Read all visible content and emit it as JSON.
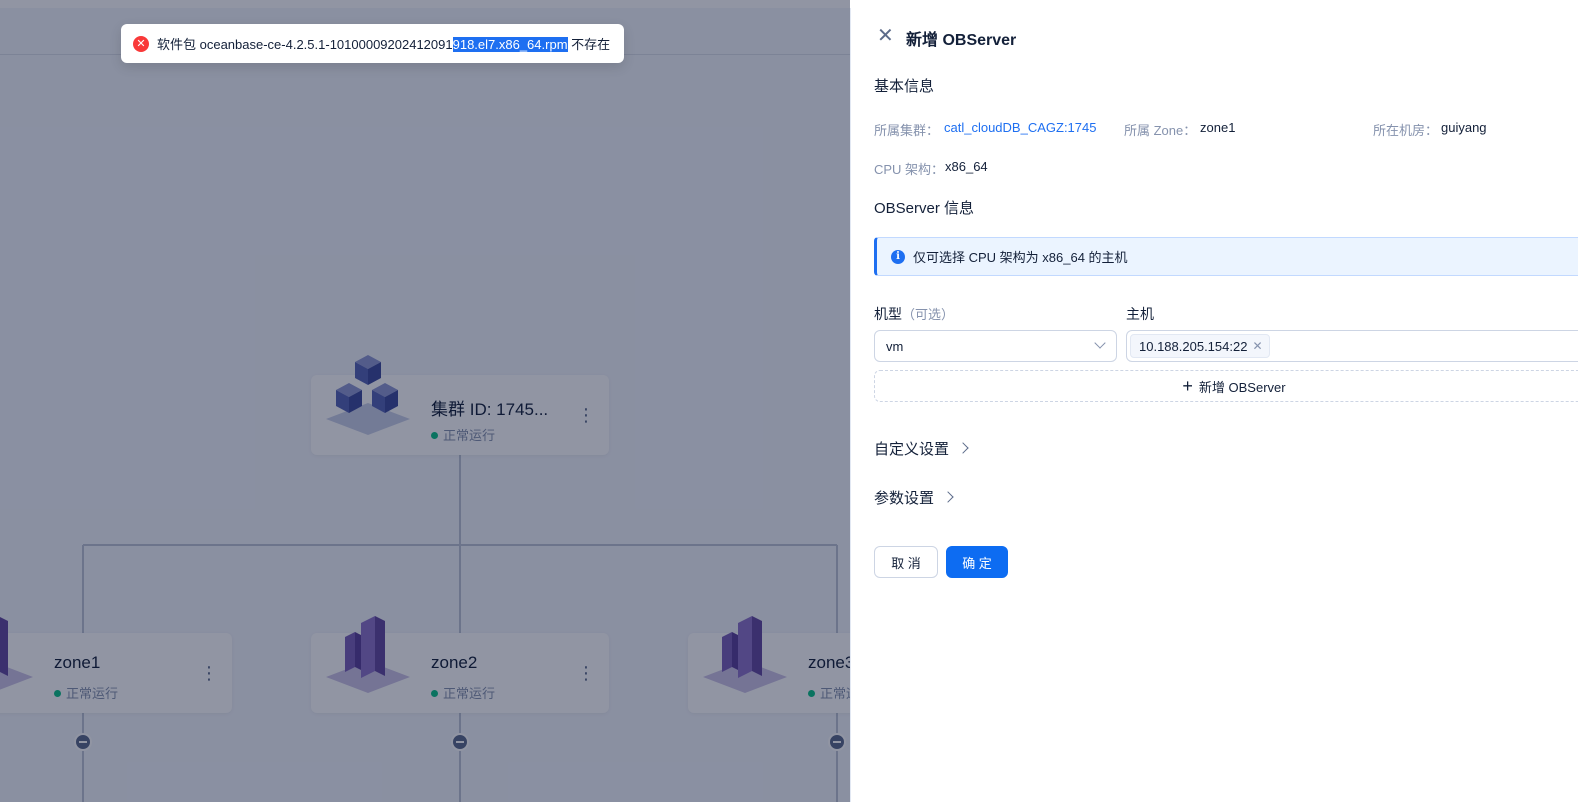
{
  "toast": {
    "prefix": "软件包 oceanbase-ce-4.2.5.1-10100009202412091",
    "highlight": "918.el7.x86_64.rpm",
    "suffix": " 不存在",
    "icon": "error-circle-icon",
    "color": "#f93939"
  },
  "topology": {
    "cluster": {
      "title": "集群 ID: 1745...",
      "status": "正常运行"
    },
    "zones": [
      {
        "title": "zone1",
        "status": "正常运行"
      },
      {
        "title": "zone2",
        "status": "正常运行"
      },
      {
        "title": "zone3",
        "status": "正常运行"
      }
    ]
  },
  "drawer": {
    "title": "新增 OBServer",
    "basic": {
      "section_title": "基本信息",
      "cluster_label": "所属集群：",
      "cluster_value": "catl_cloudDB_CAGZ:1745",
      "zone_label": "所属 Zone：",
      "zone_value": "zone1",
      "idc_label": "所在机房：",
      "idc_value": "guiyang",
      "cpu_label": "CPU 架构：",
      "cpu_value": "x86_64"
    },
    "observer": {
      "section_title": "OBServer 信息",
      "alert": "仅可选择 CPU 架构为 x86_64 的主机",
      "model_label": "机型",
      "model_optional": "（可选）",
      "host_label": "主机",
      "model_value": "vm",
      "host_tag": "10.188.205.154:22",
      "add_button": "新增 OBServer"
    },
    "custom_settings": "自定义设置",
    "param_settings": "参数设置",
    "cancel": "取 消",
    "confirm": "确 定"
  },
  "colors": {
    "primary": "#0d6cf2",
    "link": "#1e6ff1",
    "success": "#0ac185",
    "error": "#f93939"
  }
}
